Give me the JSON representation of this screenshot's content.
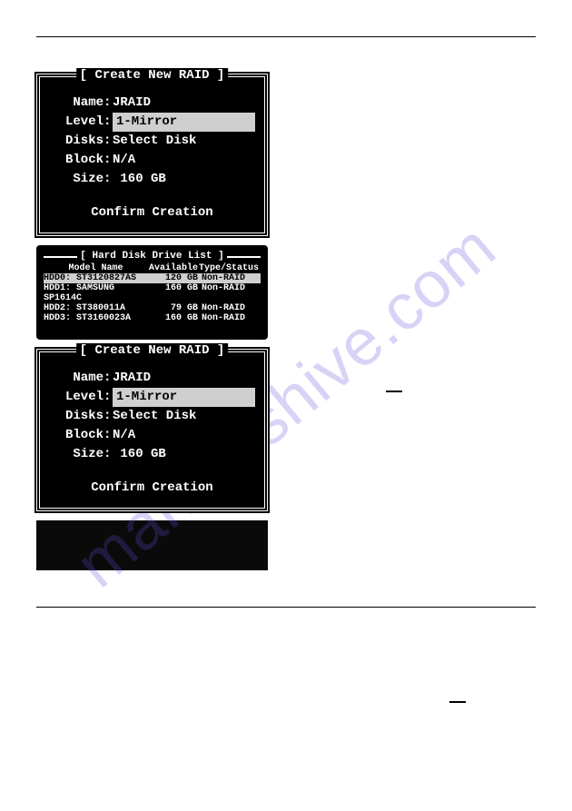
{
  "watermark": "manualshive.com",
  "box1": {
    "title": "[ Create New RAID ]",
    "name_label": "Name",
    "name_value": "JRAID",
    "level_label": "Level",
    "level_value": "1-Mirror",
    "disks_label": "Disks",
    "disks_value": "Select Disk",
    "block_label": "Block",
    "block_value": "N/A",
    "size_label": "Size",
    "size_value": " 160 GB",
    "confirm": "Confirm Creation"
  },
  "hdd": {
    "title": "[ Hard Disk Drive List ]",
    "header": {
      "c1": "Model Name",
      "c2": "Available",
      "c3": "Type/Status"
    },
    "rows": [
      {
        "c1": "HDD0: ST3120827AS",
        "c2": "120 GB",
        "c3": "Non-RAID",
        "selected": true
      },
      {
        "c1": "HDD1: SAMSUNG SP1614C",
        "c2": "160 GB",
        "c3": "Non-RAID",
        "selected": false
      },
      {
        "c1": "HDD2: ST380011A",
        "c2": "79 GB",
        "c3": "Non-RAID",
        "selected": false
      },
      {
        "c1": "HDD3: ST3160023A",
        "c2": "160 GB",
        "c3": "Non-RAID",
        "selected": false
      }
    ]
  },
  "box2": {
    "title": "[ Create New RAID ]",
    "name_label": "Name",
    "name_value": "JRAID",
    "level_label": "Level",
    "level_value": "1-Mirror",
    "disks_label": "Disks",
    "disks_value": "Select Disk",
    "block_label": "Block",
    "block_value": "N/A",
    "size_label": "Size",
    "size_value": " 160 GB",
    "confirm": "Confirm Creation"
  },
  "keys": {
    "blank1": " ",
    "blank2": " "
  }
}
